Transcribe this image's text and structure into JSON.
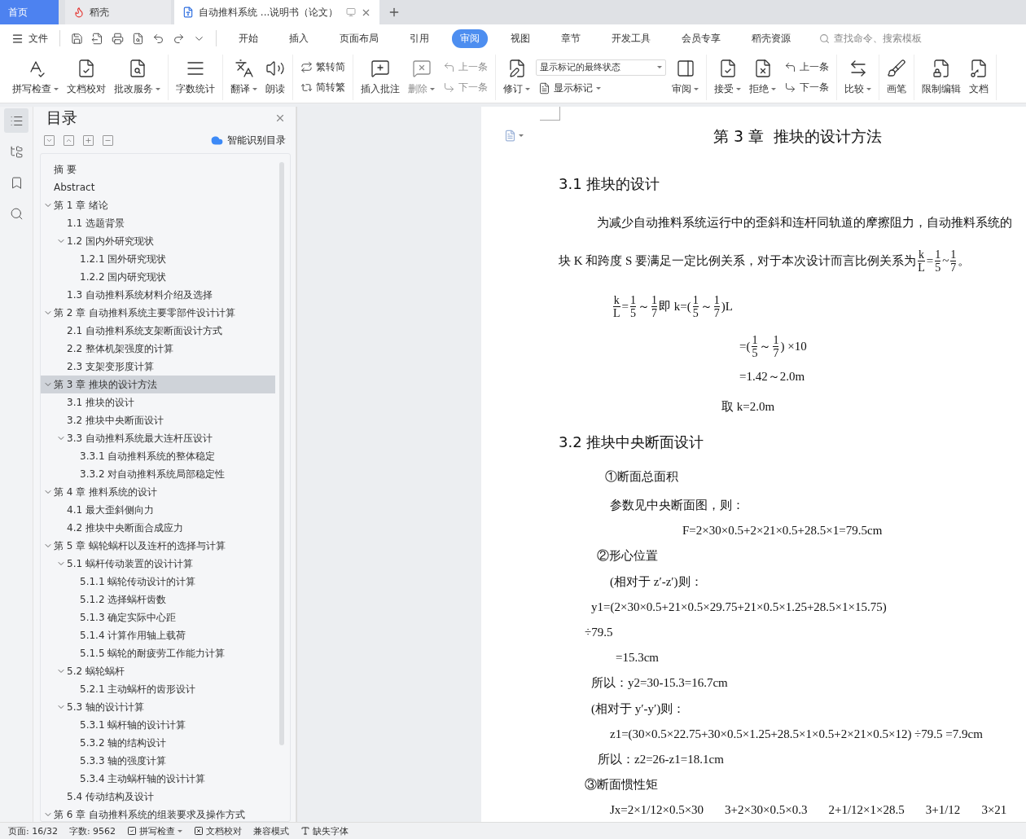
{
  "window_tabs": [
    {
      "kind": "home",
      "label": "首页",
      "selected": false
    },
    {
      "kind": "app",
      "label": "稻壳",
      "selected": false
    },
    {
      "kind": "document",
      "label": "自动推料系统 ...说明书（论文）",
      "selected": true
    }
  ],
  "menu": {
    "file_label": "文件",
    "tabs": [
      {
        "label": "开始",
        "selected": false
      },
      {
        "label": "插入",
        "selected": false
      },
      {
        "label": "页面布局",
        "selected": false
      },
      {
        "label": "引用",
        "selected": false
      },
      {
        "label": "审阅",
        "selected": true
      },
      {
        "label": "视图",
        "selected": false
      },
      {
        "label": "章节",
        "selected": false
      },
      {
        "label": "开发工具",
        "selected": false
      },
      {
        "label": "会员专享",
        "selected": false
      },
      {
        "label": "稻壳资源",
        "selected": false
      }
    ],
    "search": {
      "placeholder": "查找命令、搜索模板"
    }
  },
  "ribbon": {
    "groups": [
      {
        "items": [
          {
            "kind": "large",
            "label": "拼写检查",
            "dropdown": true,
            "disabled": false
          },
          {
            "kind": "large",
            "label": "文档校对",
            "dropdown": false,
            "disabled": false
          },
          {
            "kind": "large",
            "label": "批改服务",
            "dropdown": true,
            "disabled": false
          }
        ]
      },
      {
        "items": [
          {
            "kind": "large",
            "label": "字数统计",
            "dropdown": false,
            "disabled": false
          }
        ]
      },
      {
        "items": [
          {
            "kind": "large",
            "label": "翻译",
            "dropdown": true,
            "disabled": false
          },
          {
            "kind": "large",
            "label": "朗读",
            "dropdown": false,
            "disabled": false
          }
        ]
      },
      {
        "items": [
          {
            "kind": "small",
            "label": "繁转简",
            "dropdown": false,
            "disabled": false
          },
          {
            "kind": "small",
            "label": "简转繁",
            "dropdown": false,
            "disabled": false
          }
        ]
      },
      {
        "items": [
          {
            "kind": "large",
            "label": "插入批注",
            "dropdown": false,
            "disabled": false
          },
          {
            "kind": "large",
            "label": "删除",
            "dropdown": true,
            "disabled": true
          },
          {
            "kind": "small",
            "label": "上一条",
            "dropdown": false,
            "disabled": true
          },
          {
            "kind": "small",
            "label": "下一条",
            "dropdown": false,
            "disabled": true
          }
        ]
      },
      {
        "items": [
          {
            "kind": "large",
            "label": "修订",
            "dropdown": true,
            "disabled": false
          },
          {
            "kind": "select",
            "label": "显示标记的最终状态",
            "dropdown": true,
            "disabled": false
          },
          {
            "kind": "small",
            "label": "显示标记",
            "dropdown": true,
            "disabled": false
          },
          {
            "kind": "large",
            "label": "审阅",
            "dropdown": true,
            "disabled": false
          }
        ]
      },
      {
        "items": [
          {
            "kind": "large",
            "label": "接受",
            "dropdown": true,
            "disabled": false
          },
          {
            "kind": "large",
            "label": "拒绝",
            "dropdown": true,
            "disabled": false
          },
          {
            "kind": "small",
            "label": "上一条",
            "dropdown": false,
            "disabled": false
          },
          {
            "kind": "small",
            "label": "下一条",
            "dropdown": false,
            "disabled": false
          }
        ]
      },
      {
        "items": [
          {
            "kind": "large",
            "label": "比较",
            "dropdown": true,
            "disabled": false
          }
        ]
      },
      {
        "items": [
          {
            "kind": "large",
            "label": "画笔",
            "dropdown": false,
            "disabled": false
          }
        ]
      },
      {
        "items": [
          {
            "kind": "large",
            "label": "限制编辑",
            "dropdown": false,
            "disabled": false
          },
          {
            "kind": "large",
            "label": "文档",
            "dropdown": false,
            "disabled": false
          }
        ]
      }
    ]
  },
  "side_rail": [
    {
      "selected": true
    },
    {
      "selected": false
    },
    {
      "selected": false
    },
    {
      "selected": false
    }
  ],
  "toc": {
    "title": "目录",
    "smart_label": "智能识别目录",
    "items": [
      {
        "label": "摘 要",
        "selected": false
      },
      {
        "label": "Abstract",
        "selected": false
      },
      {
        "label": "第 1 章 绪论",
        "selected": false,
        "expanded": true,
        "children": [
          {
            "label": "1.1 选题背景",
            "selected": false
          },
          {
            "label": "1.2 国内外研究现状",
            "selected": false,
            "expanded": true,
            "children": [
              {
                "label": "1.2.1 国外研究现状",
                "selected": false
              },
              {
                "label": "1.2.2 国内研究现状",
                "selected": false
              }
            ]
          },
          {
            "label": "1.3 自动推料系统材料介绍及选择",
            "selected": false
          }
        ]
      },
      {
        "label": "第 2 章 自动推料系统主要零部件设计计算",
        "selected": false,
        "expanded": true,
        "children": [
          {
            "label": "2.1 自动推料系统支架断面设计方式",
            "selected": false
          },
          {
            "label": "2.2 整体机架强度的计算",
            "selected": false
          },
          {
            "label": "2.3 支架变形度计算",
            "selected": false
          }
        ]
      },
      {
        "label": "第 3 章 推块的设计方法",
        "selected": true,
        "expanded": true,
        "children": [
          {
            "label": "3.1 推块的设计",
            "selected": false
          },
          {
            "label": "3.2 推块中央断面设计",
            "selected": false
          },
          {
            "label": "3.3 自动推料系统最大连杆压设计",
            "selected": false,
            "expanded": true,
            "children": [
              {
                "label": "3.3.1 自动推料系统的整体稳定",
                "selected": false
              },
              {
                "label": "3.3.2 对自动推料系统局部稳定性",
                "selected": false
              }
            ]
          }
        ]
      },
      {
        "label": "第 4 章 推料系统的设计",
        "selected": false,
        "expanded": true,
        "children": [
          {
            "label": "4.1 最大歪斜侧向力",
            "selected": false
          },
          {
            "label": "4.2 推块中央断面合成应力",
            "selected": false
          }
        ]
      },
      {
        "label": "第 5 章 蜗轮蜗杆以及连杆的选择与计算",
        "selected": false,
        "expanded": true,
        "children": [
          {
            "label": "5.1 蜗杆传动装置的设计计算",
            "selected": false,
            "expanded": true,
            "children": [
              {
                "label": "5.1.1 蜗轮传动设计的计算",
                "selected": false
              },
              {
                "label": "5.1.2 选择蜗杆齿数",
                "selected": false
              },
              {
                "label": "5.1.3 确定实际中心距",
                "selected": false
              },
              {
                "label": "5.1.4 计算作用轴上载荷",
                "selected": false
              },
              {
                "label": "5.1.5 蜗轮的耐疲劳工作能力计算",
                "selected": false
              }
            ]
          },
          {
            "label": "5.2 蜗轮蜗杆",
            "selected": false,
            "expanded": true,
            "children": [
              {
                "label": "5.2.1 主动蜗杆的齿形设计",
                "selected": false
              }
            ]
          },
          {
            "label": "5.3 轴的设计计算",
            "selected": false,
            "expanded": true,
            "children": [
              {
                "label": "5.3.1 蜗杆轴的设计计算",
                "selected": false
              },
              {
                "label": "5.3.2 轴的结构设计",
                "selected": false
              },
              {
                "label": "5.3.3 轴的强度计算",
                "selected": false
              },
              {
                "label": "5.3.4 主动蜗杆轴的设计计算",
                "selected": false
              }
            ]
          },
          {
            "label": "5.4 传动结构及设计",
            "selected": false
          }
        ]
      },
      {
        "label": "第 6 章 自动推料系统的组装要求及操作方式",
        "selected": false,
        "expanded": true
      }
    ]
  },
  "document": {
    "blocks": [
      {
        "kind": "chapter",
        "text": "第 3 章  推块的设计方法"
      },
      {
        "kind": "heading",
        "text": "3.1 推块的设计"
      },
      {
        "kind": "line",
        "parts": [
          {
            "kind": "text",
            "text": "为减少自动推料系统运行中的歪斜和连杆同轨道的摩擦阻力，自动推料系统的"
          }
        ]
      },
      {
        "kind": "line",
        "parts": [
          {
            "kind": "text",
            "text": "块 K 和跨度 S 要满足一定比例关系，对于本次设计而言比例关系为"
          },
          {
            "kind": "fraction",
            "numerator": "k",
            "denominator": "L"
          },
          {
            "kind": "text",
            "text": "="
          },
          {
            "kind": "fraction",
            "numerator": "1",
            "denominator": "5"
          },
          {
            "kind": "text",
            "text": "~"
          },
          {
            "kind": "fraction",
            "numerator": "1",
            "denominator": "7"
          },
          {
            "kind": "text",
            "text": "。"
          }
        ]
      },
      {
        "kind": "line",
        "parts": [
          {
            "kind": "fraction",
            "numerator": "k",
            "denominator": "L"
          },
          {
            "kind": "text",
            "text": "="
          },
          {
            "kind": "fraction",
            "numerator": "1",
            "denominator": "5"
          },
          {
            "kind": "text",
            "text": "～"
          },
          {
            "kind": "fraction",
            "numerator": "1",
            "denominator": "7"
          },
          {
            "kind": "text",
            "text": "即 k=("
          },
          {
            "kind": "fraction",
            "numerator": "1",
            "denominator": "5"
          },
          {
            "kind": "text",
            "text": "～"
          },
          {
            "kind": "fraction",
            "numerator": "1",
            "denominator": "7"
          },
          {
            "kind": "text",
            "text": ")L"
          }
        ]
      },
      {
        "kind": "line",
        "parts": [
          {
            "kind": "text",
            "text": "=("
          },
          {
            "kind": "fraction",
            "numerator": "1",
            "denominator": "5"
          },
          {
            "kind": "text",
            "text": "～"
          },
          {
            "kind": "fraction",
            "numerator": "1",
            "denominator": "7"
          },
          {
            "kind": "text",
            "text": ") ×10"
          }
        ]
      },
      {
        "kind": "line",
        "parts": [
          {
            "kind": "text",
            "text": "=1.42～2.0m"
          }
        ]
      },
      {
        "kind": "line",
        "parts": [
          {
            "kind": "text",
            "text": "取 k=2.0m"
          }
        ]
      },
      {
        "kind": "heading",
        "text": "3.2 推块中央断面设计"
      },
      {
        "kind": "line",
        "parts": [
          {
            "kind": "text",
            "text": "①断面总面积"
          }
        ]
      },
      {
        "kind": "line",
        "parts": [
          {
            "kind": "text",
            "text": "参数见中央断面图，则："
          }
        ]
      },
      {
        "kind": "line",
        "parts": [
          {
            "kind": "text",
            "text": "F=2×30×0.5+2×21×0.5+28.5×1=79.5cm"
          }
        ]
      },
      {
        "kind": "line",
        "parts": [
          {
            "kind": "text",
            "text": "②形心位置"
          }
        ]
      },
      {
        "kind": "line",
        "parts": [
          {
            "kind": "text",
            "text": "(相对于 z′-z′)则："
          }
        ]
      },
      {
        "kind": "line",
        "parts": [
          {
            "kind": "text",
            "text": "y1=(2×30×0.5+21×0.5×29.75+21×0.5×1.25+28.5×1×15.75)"
          }
        ]
      },
      {
        "kind": "line",
        "parts": [
          {
            "kind": "text",
            "text": "÷79.5"
          }
        ]
      },
      {
        "kind": "line",
        "parts": [
          {
            "kind": "text",
            "text": "=15.3cm"
          }
        ]
      },
      {
        "kind": "line",
        "parts": [
          {
            "kind": "text",
            "text": "所以：y2=30-15.3=16.7cm"
          }
        ]
      },
      {
        "kind": "line",
        "parts": [
          {
            "kind": "text",
            "text": "(相对于 y′-y′)则："
          }
        ]
      },
      {
        "kind": "line",
        "parts": [
          {
            "kind": "text",
            "text": "z1=(30×0.5×22.75+30×0.5×1.25+28.5×1×0.5+2×21×0.5×12) ÷79.5 =7.9cm"
          }
        ]
      },
      {
        "kind": "line",
        "parts": [
          {
            "kind": "text",
            "text": "所以：z2=26-z1=18.1cm"
          }
        ]
      },
      {
        "kind": "line",
        "parts": [
          {
            "kind": "text",
            "text": "③断面惯性矩"
          }
        ]
      },
      {
        "kind": "spaced",
        "parts": [
          {
            "kind": "text",
            "text": "Jx=2×1/12×0.5×30"
          },
          {
            "kind": "text",
            "text": "3+2×30×0.5×0.3"
          },
          {
            "kind": "text",
            "text": "2+1/12×1×28.5"
          },
          {
            "kind": "text",
            "text": "3+1/12"
          },
          {
            "kind": "text",
            "text": "3×21"
          }
        ]
      }
    ]
  },
  "status_bar": [
    {
      "kind": "plain",
      "label": "页面: 16/32"
    },
    {
      "kind": "plain",
      "label": "字数: 9562"
    },
    {
      "kind": "checkbox",
      "label": "拼写检查"
    },
    {
      "kind": "crossbox",
      "label": "文档校对"
    },
    {
      "kind": "plain",
      "label": "兼容模式"
    },
    {
      "kind": "font",
      "label": "缺失字体"
    }
  ]
}
